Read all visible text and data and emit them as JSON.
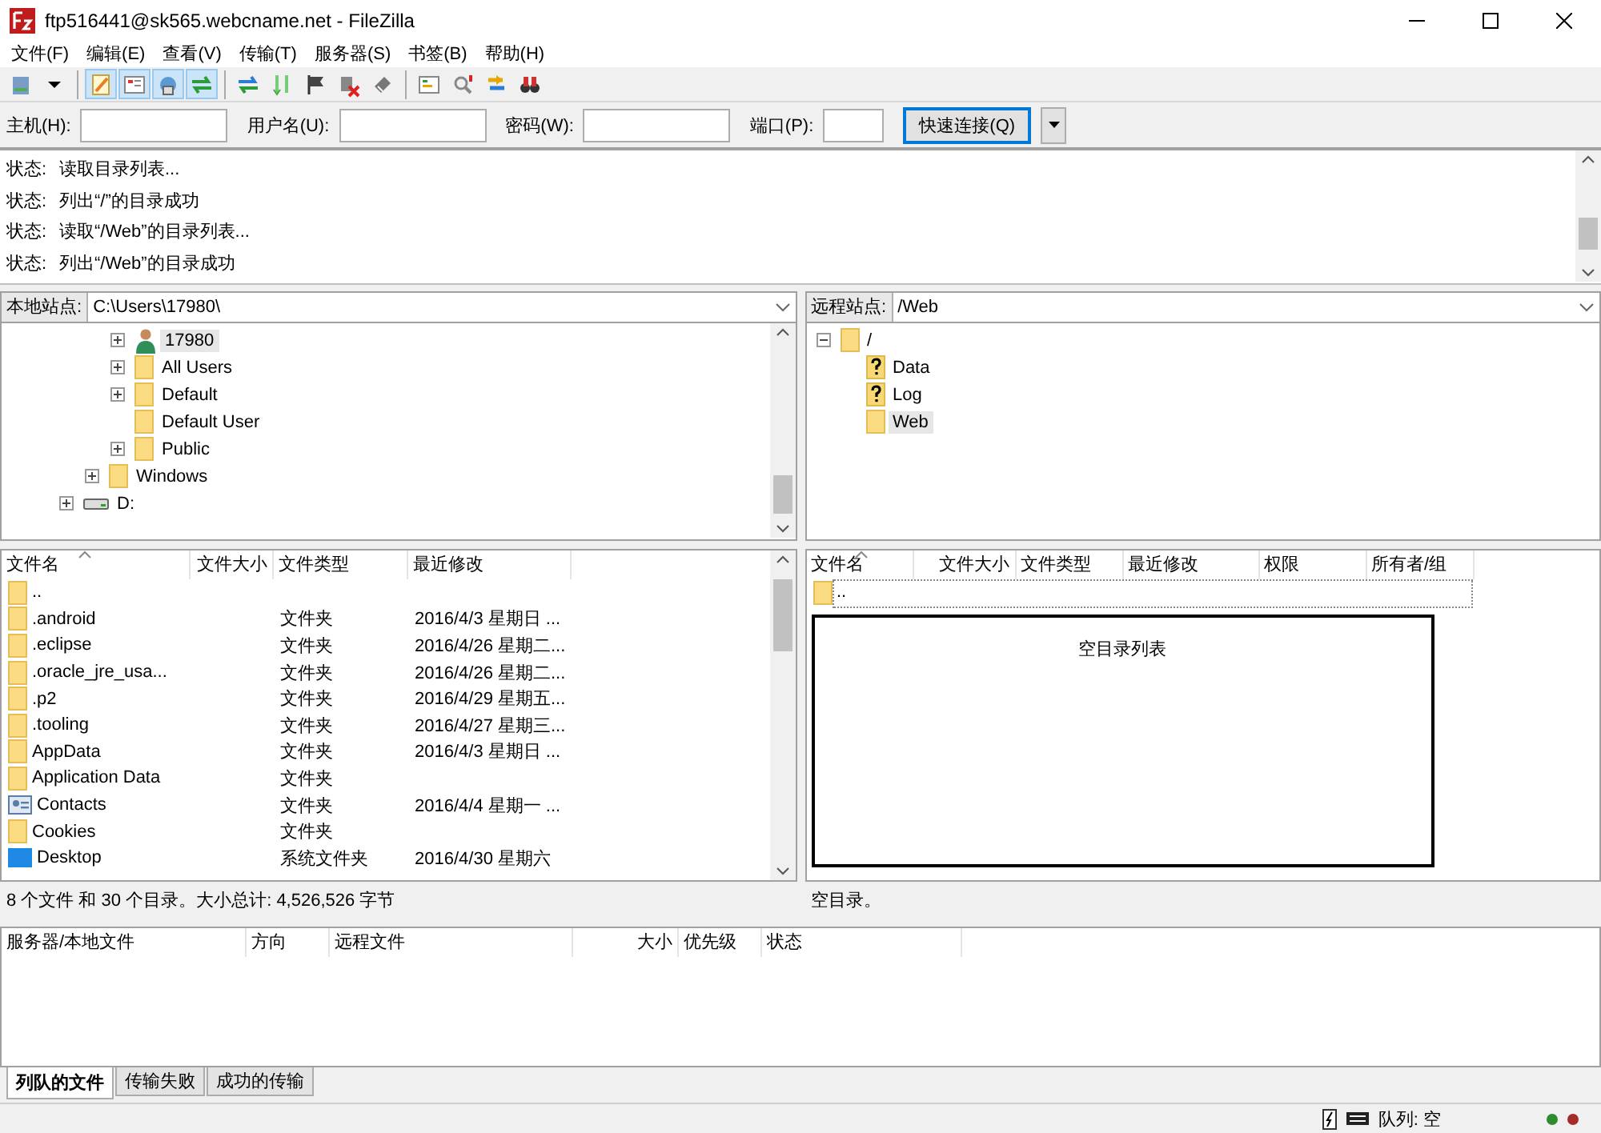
{
  "window": {
    "title": "ftp516441@sk565.webcname.net - FileZilla"
  },
  "menu": [
    "文件(F)",
    "编辑(E)",
    "查看(V)",
    "传输(T)",
    "服务器(S)",
    "书签(B)",
    "帮助(H)"
  ],
  "toolbar": [
    {
      "pressed": false
    },
    {
      "pressed": false
    },
    {
      "pressed": true
    },
    {
      "pressed": true
    },
    {
      "pressed": true
    },
    {
      "pressed": true
    },
    {
      "pressed": false
    },
    {
      "pressed": false
    },
    {
      "pressed": false
    },
    {
      "pressed": false
    },
    {
      "pressed": false
    },
    {
      "pressed": false
    },
    {
      "pressed": false
    },
    {
      "pressed": false
    },
    {
      "pressed": false
    }
  ],
  "quickconnect": {
    "fields": [
      {
        "label": "主机(H):"
      },
      {
        "label": "用户名(U):"
      },
      {
        "label": "密码(W):"
      },
      {
        "label": "端口(P):"
      }
    ],
    "button": "快速连接(Q)"
  },
  "log": [
    {
      "label": "状态:",
      "text": "读取目录列表..."
    },
    {
      "label": "状态:",
      "text": "列出“/”的目录成功"
    },
    {
      "label": "状态:",
      "text": "读取“/Web”的目录列表..."
    },
    {
      "label": "状态:",
      "text": "列出“/Web”的目录成功"
    }
  ],
  "local": {
    "site_label": "本地站点:",
    "path": "C:\\Users\\17980\\",
    "tree": [
      {
        "children": [
          {
            "children": [
              {
                "label": "17980",
                "kind": "user",
                "expandable": true,
                "expanded": false,
                "selected": true
              },
              {
                "label": "All Users",
                "kind": "folder",
                "expandable": true,
                "expanded": false,
                "selected": false
              },
              {
                "label": "Default",
                "kind": "folder",
                "expandable": true,
                "expanded": false,
                "selected": false
              },
              {
                "label": "Default User",
                "kind": "folder",
                "expandable": false,
                "selected": false
              },
              {
                "label": "Public",
                "kind": "folder",
                "expandable": true,
                "expanded": false,
                "selected": false
              }
            ]
          },
          {
            "label": "Windows",
            "kind": "folder",
            "expandable": true,
            "expanded": false,
            "selected": false
          }
        ]
      },
      {
        "label": "D:",
        "kind": "drive",
        "expandable": true,
        "expanded": false,
        "selected": false
      }
    ],
    "columns": [
      {
        "label": "文件名",
        "sorted": true
      },
      {
        "label": "文件大小",
        "sorted": false
      },
      {
        "label": "文件类型",
        "sorted": false
      },
      {
        "label": "最近修改",
        "sorted": false
      }
    ],
    "rows": [
      {
        "kind": "folder",
        "cells": [
          "..",
          "",
          "",
          ""
        ]
      },
      {
        "kind": "folder",
        "cells": [
          ".android",
          "",
          "文件夹",
          "2016/4/3 星期日 ..."
        ]
      },
      {
        "kind": "folder",
        "cells": [
          ".eclipse",
          "",
          "文件夹",
          "2016/4/26 星期二..."
        ]
      },
      {
        "kind": "folder",
        "cells": [
          ".oracle_jre_usa...",
          "",
          "文件夹",
          "2016/4/26 星期二..."
        ]
      },
      {
        "kind": "folder",
        "cells": [
          ".p2",
          "",
          "文件夹",
          "2016/4/29 星期五..."
        ]
      },
      {
        "kind": "folder",
        "cells": [
          ".tooling",
          "",
          "文件夹",
          "2016/4/27 星期三..."
        ]
      },
      {
        "kind": "folder",
        "cells": [
          "AppData",
          "",
          "文件夹",
          "2016/4/3 星期日 ..."
        ]
      },
      {
        "kind": "folder",
        "cells": [
          "Application Data",
          "",
          "文件夹",
          ""
        ]
      },
      {
        "kind": "contacts",
        "cells": [
          "Contacts",
          "",
          "文件夹",
          "2016/4/4 星期一 ..."
        ]
      },
      {
        "kind": "folder",
        "cells": [
          "Cookies",
          "",
          "文件夹",
          ""
        ]
      },
      {
        "kind": "desktop",
        "cells": [
          "Desktop",
          "",
          "系统文件夹",
          "2016/4/30 星期六"
        ]
      }
    ],
    "status": "8 个文件 和 30 个目录。大小总计: 4,526,526 字节"
  },
  "remote": {
    "site_label": "远程站点:",
    "path": "/Web",
    "tree": [
      {
        "label": "/",
        "kind": "folder",
        "expandable": true,
        "expanded": true,
        "selected": false,
        "children": [
          {
            "label": "Data",
            "kind": "unknown",
            "expandable": false,
            "selected": false
          },
          {
            "label": "Log",
            "kind": "unknown",
            "expandable": false,
            "selected": false
          },
          {
            "label": "Web",
            "kind": "folder",
            "expandable": false,
            "selected": true
          }
        ]
      }
    ],
    "columns": [
      {
        "label": "文件名",
        "sorted": true
      },
      {
        "label": "文件大小",
        "sorted": false
      },
      {
        "label": "文件类型",
        "sorted": false
      },
      {
        "label": "最近修改",
        "sorted": false
      },
      {
        "label": "权限",
        "sorted": false
      },
      {
        "label": "所有者/组",
        "sorted": false
      }
    ],
    "rows": [
      {
        "kind": "folder",
        "cells": [
          "..",
          "",
          "",
          "",
          "",
          ""
        ]
      }
    ],
    "empty_message": "空目录列表",
    "status": "空目录。"
  },
  "queue": {
    "columns": [
      "服务器/本地文件",
      "方向",
      "远程文件",
      "大小",
      "优先级",
      "状态"
    ]
  },
  "tabs": [
    {
      "label": "列队的文件",
      "selected": true
    },
    {
      "label": "传输失败",
      "selected": false
    },
    {
      "label": "成功的传输",
      "selected": false
    }
  ],
  "status_bar": {
    "queue": "队列: 空",
    "lights": [
      {
        "color": "#2e8b2e"
      },
      {
        "color": "#a52a2a"
      }
    ]
  }
}
